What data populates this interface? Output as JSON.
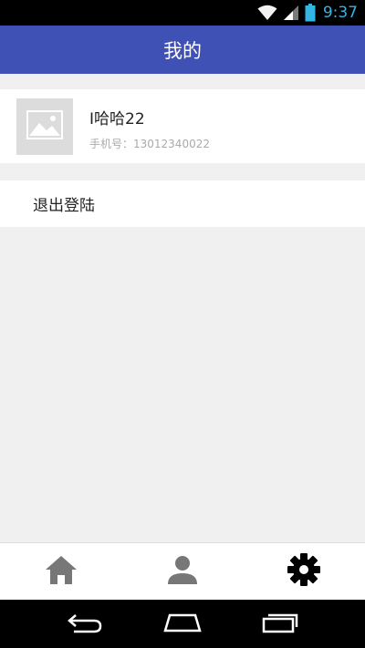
{
  "status_bar": {
    "time": "9:37",
    "icons": [
      "wifi-icon",
      "signal-icon",
      "battery-icon"
    ]
  },
  "app_bar": {
    "title": "我的"
  },
  "profile": {
    "avatar_icon": "image-placeholder-icon",
    "username": "I哈哈22",
    "phone": "手机号：13012340022"
  },
  "menu": {
    "logout_label": "退出登陆"
  },
  "bottom_nav": {
    "tabs": [
      {
        "icon": "home-icon"
      },
      {
        "icon": "person-icon"
      },
      {
        "icon": "gear-icon",
        "active": true
      }
    ]
  },
  "system_nav": {
    "buttons": [
      "back-icon",
      "home-outline-icon",
      "recents-icon"
    ]
  },
  "colors": {
    "app_bar": "#3f51b5",
    "background": "#f0f0f0",
    "status_time": "#33b5e5",
    "inactive_tab": "#777777",
    "active_tab": "#000000"
  }
}
